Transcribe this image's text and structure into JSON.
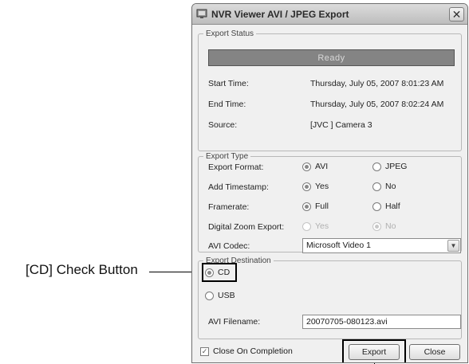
{
  "callout": {
    "label": "[CD] Check Button"
  },
  "window": {
    "title": "NVR Viewer AVI / JPEG Export",
    "close_glyph": "✕"
  },
  "export_status": {
    "legend": "Export Status",
    "status_text": "Ready",
    "start_label": "Start Time:",
    "start_value": "Thursday, July 05, 2007 8:01:23 AM",
    "end_label": "End Time:",
    "end_value": "Thursday, July 05, 2007 8:02:24 AM",
    "source_label": "Source:",
    "source_value": "[JVC ] Camera 3"
  },
  "export_type": {
    "legend": "Export Type",
    "format_label": "Export Format:",
    "format_opt1": "AVI",
    "format_opt2": "JPEG",
    "timestamp_label": "Add Timestamp:",
    "timestamp_opt1": "Yes",
    "timestamp_opt2": "No",
    "framerate_label": "Framerate:",
    "framerate_opt1": "Full",
    "framerate_opt2": "Half",
    "zoom_label": "Digital Zoom Export:",
    "zoom_opt1": "Yes",
    "zoom_opt2": "No",
    "codec_label": "AVI Codec:",
    "codec_value": "Microsoft Video 1"
  },
  "export_destination": {
    "legend": "Export Destination",
    "cd_label": "CD",
    "usb_label": "USB",
    "filename_label": "AVI Filename:",
    "filename_value": "20070705-080123.avi"
  },
  "footer": {
    "close_on_completion": "Close On Completion",
    "export_button": "Export",
    "close_button": "Close"
  },
  "icons": {
    "title_icon": "camera-window-icon",
    "dropdown": "chevron-down-icon"
  }
}
